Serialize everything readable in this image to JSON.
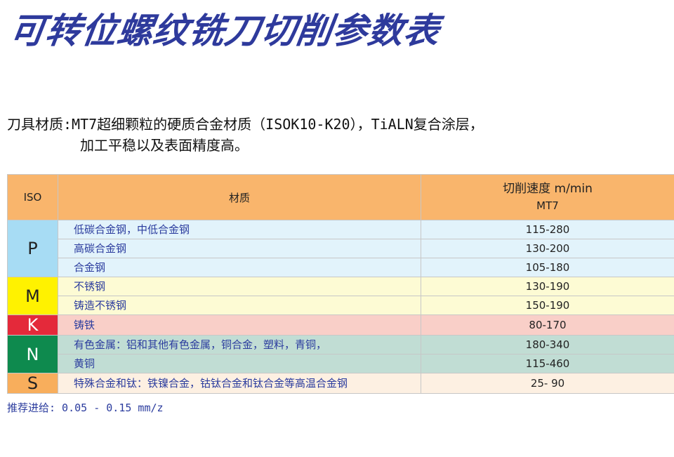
{
  "title": "可转位螺纹铣刀切削参数表",
  "description": {
    "line1": "刀具材质:MT7超细颗粒的硬质合金材质（ISOK10-K20），TiALN复合涂层，",
    "line2": "加工平稳以及表面精度高。"
  },
  "table": {
    "headers": {
      "iso": "ISO",
      "material": "材质",
      "speed": "切削速度 m/min",
      "grade": "MT7"
    },
    "groups": [
      {
        "iso": "P",
        "materials": [
          "低碳合金钢，中低合金钢",
          "高碳合金钢",
          "合金钢"
        ],
        "speeds": [
          "115-280",
          "130-200",
          "105-180"
        ]
      },
      {
        "iso": "M",
        "materials": [
          "不锈钢",
          "铸造不锈钢"
        ],
        "speeds": [
          "130-190",
          "150-190"
        ]
      },
      {
        "iso": "K",
        "materials": [
          "铸铁"
        ],
        "speeds": [
          "80-170"
        ]
      },
      {
        "iso": "N",
        "materials": [
          "有色金属：铝和其他有色金属，铜合金，塑料，青铜，",
          "黄铜"
        ],
        "speeds": [
          "180-340",
          "115-460"
        ]
      },
      {
        "iso": "S",
        "materials": [
          "特殊合金和钛：铁镍合金，钴钛合金和钛合金等高温合金钢"
        ],
        "speeds": [
          "25- 90"
        ]
      }
    ]
  },
  "feed": "推荐进给: 0.05 - 0.15 mm/z",
  "colors": {
    "title": "#2e3a9c",
    "header": "#f9b56c",
    "P": "#a7dcf4",
    "M": "#fff200",
    "K": "#e4293a",
    "N": "#0e8a4e",
    "S": "#f8ae5c"
  }
}
